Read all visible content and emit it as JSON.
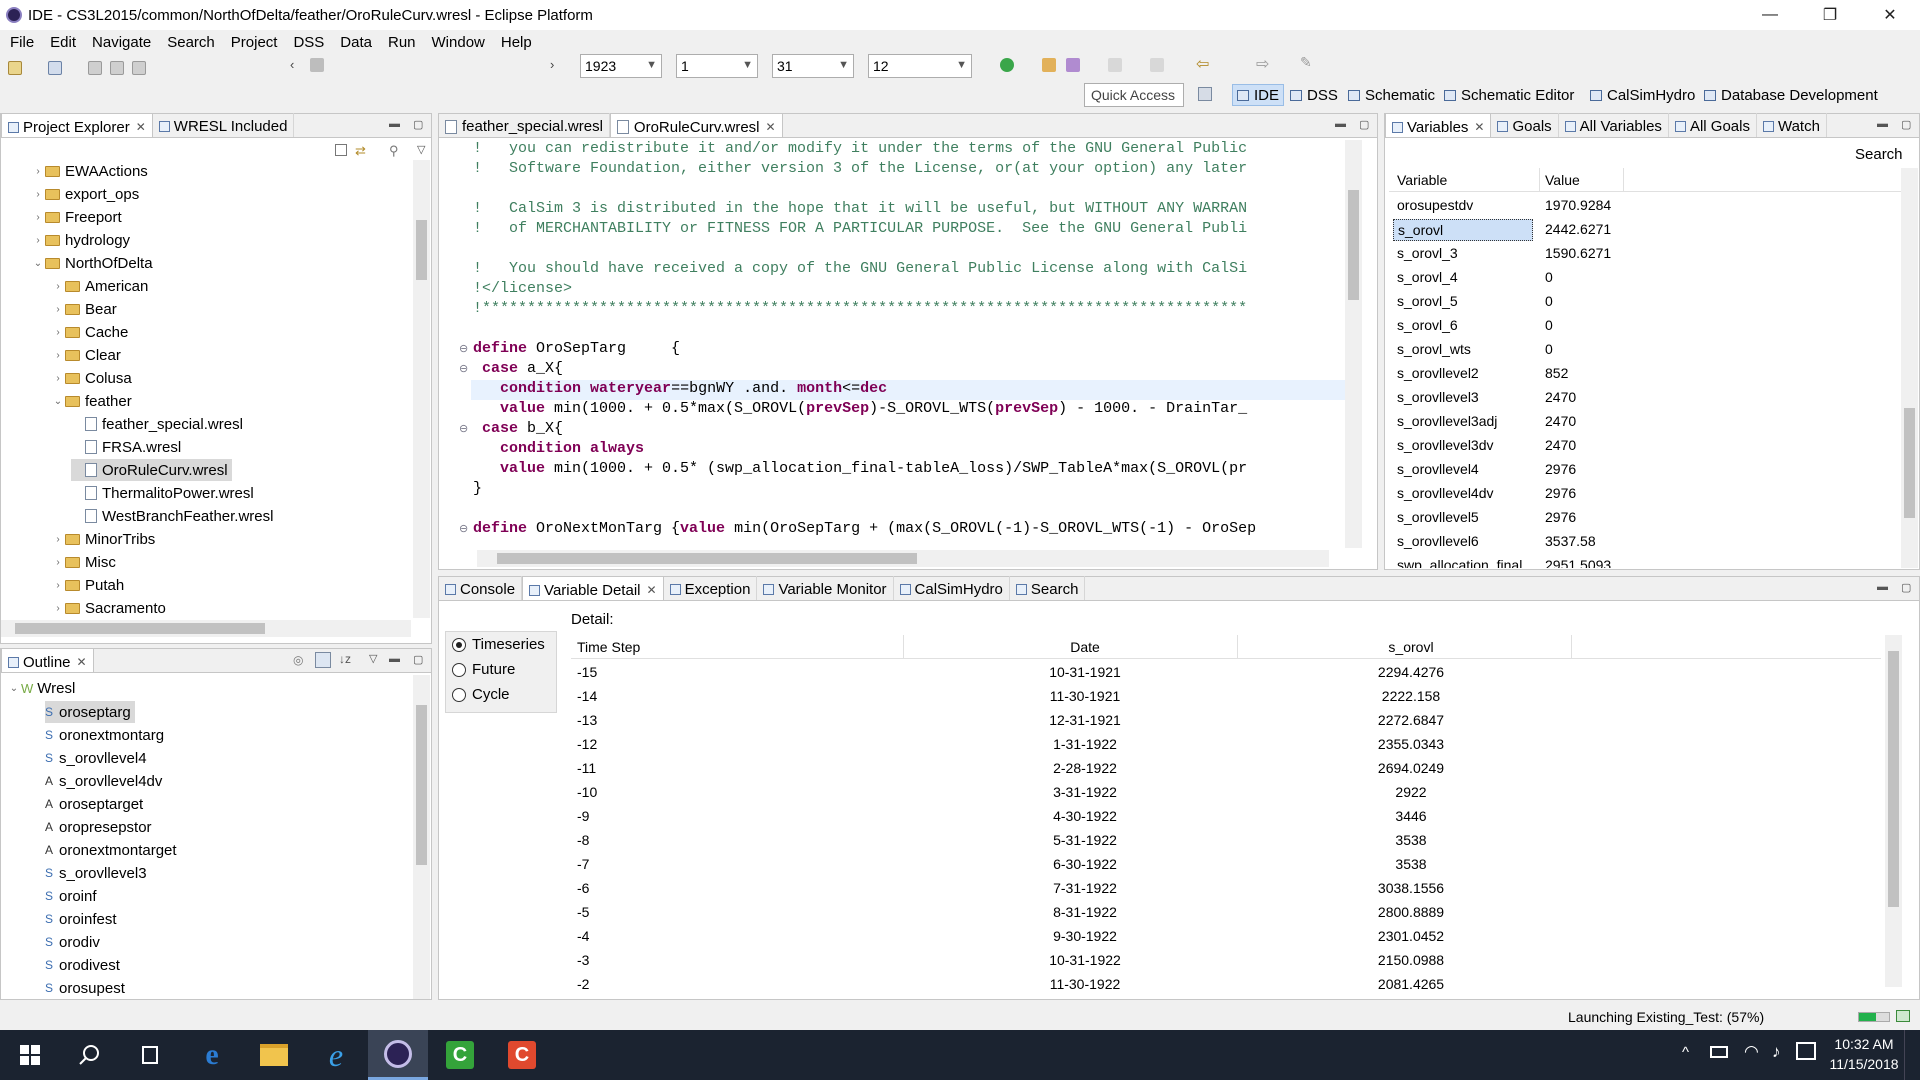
{
  "window": {
    "title": "IDE - CS3L2015/common/NorthOfDelta/feather/OroRuleCurv.wresl - Eclipse Platform",
    "minimize": "—",
    "restore": "❐",
    "close": "✕"
  },
  "menu": [
    "File",
    "Edit",
    "Navigate",
    "Search",
    "Project",
    "DSS",
    "Data",
    "Run",
    "Window",
    "Help"
  ],
  "toolbar": {
    "year": "1923",
    "day": "1",
    "day2": "31",
    "month": "12",
    "quick_access": "Quick Access"
  },
  "perspectives": [
    "IDE",
    "DSS",
    "Schematic",
    "Schematic Editor",
    "CalSimHydro",
    "Database Development"
  ],
  "left_top": {
    "tabs": [
      "Project Explorer",
      "WRESL Included"
    ],
    "items": [
      {
        "label": "EWAActions",
        "type": "folder",
        "twist": "›"
      },
      {
        "label": "export_ops",
        "type": "folder",
        "twist": "›"
      },
      {
        "label": "Freeport",
        "type": "folder",
        "twist": "›"
      },
      {
        "label": "hydrology",
        "type": "folder",
        "twist": "›"
      },
      {
        "label": "NorthOfDelta",
        "type": "folder",
        "twist": "⌄"
      },
      {
        "label": "American",
        "type": "folder",
        "twist": "›"
      },
      {
        "label": "Bear",
        "type": "folder",
        "twist": "›"
      },
      {
        "label": "Cache",
        "type": "folder",
        "twist": "›"
      },
      {
        "label": "Clear",
        "type": "folder",
        "twist": "›"
      },
      {
        "label": "Colusa",
        "type": "folder",
        "twist": "›"
      },
      {
        "label": "feather",
        "type": "folder",
        "twist": "⌄"
      },
      {
        "label": "feather_special.wresl",
        "type": "file",
        "twist": ""
      },
      {
        "label": "FRSA.wresl",
        "type": "file",
        "twist": ""
      },
      {
        "label": "OroRuleCurv.wresl",
        "type": "file",
        "twist": ""
      },
      {
        "label": "ThermalitoPower.wresl",
        "type": "file",
        "twist": ""
      },
      {
        "label": "WestBranchFeather.wresl",
        "type": "file",
        "twist": ""
      },
      {
        "label": "MinorTribs",
        "type": "folder",
        "twist": "›"
      },
      {
        "label": "Misc",
        "type": "folder",
        "twist": "›"
      },
      {
        "label": "Putah",
        "type": "folder",
        "twist": "›"
      },
      {
        "label": "Sacramento",
        "type": "folder",
        "twist": "›"
      }
    ]
  },
  "outline": {
    "tab": "Outline",
    "root": "Wresl",
    "items": [
      {
        "prefix": "S",
        "label": "oroseptarg"
      },
      {
        "prefix": "S",
        "label": "oronextmontarg"
      },
      {
        "prefix": "S",
        "label": "s_orovllevel4"
      },
      {
        "prefix": "A",
        "label": "s_orovllevel4dv"
      },
      {
        "prefix": "A",
        "label": "oroseptarget"
      },
      {
        "prefix": "A",
        "label": "oropresepstor"
      },
      {
        "prefix": "A",
        "label": "oronextmontarget"
      },
      {
        "prefix": "S",
        "label": "s_orovllevel3"
      },
      {
        "prefix": "S",
        "label": "oroinf"
      },
      {
        "prefix": "S",
        "label": "oroinfest"
      },
      {
        "prefix": "S",
        "label": "orodiv"
      },
      {
        "prefix": "S",
        "label": "orodivest"
      },
      {
        "prefix": "S",
        "label": "orosupest"
      }
    ]
  },
  "editor": {
    "tabs": [
      "feather_special.wresl",
      "OroRuleCurv.wresl"
    ],
    "lines": [
      {
        "t": "!   you can redistribute it and/or modify it under the terms of the GNU General Public",
        "c": "cm"
      },
      {
        "t": "!   Software Foundation, either version 3 of the License, or(at your option) any later",
        "c": "cm"
      },
      {
        "t": "",
        "c": ""
      },
      {
        "t": "!   CalSim 3 is distributed in the hope that it will be useful, but WITHOUT ANY WARRAN",
        "c": "cm"
      },
      {
        "t": "!   of MERCHANTABILITY or FITNESS FOR A PARTICULAR PURPOSE.  See the GNU General Publi",
        "c": "cm"
      },
      {
        "t": "",
        "c": ""
      },
      {
        "t": "!   You should have received a copy of the GNU General Public License along with CalSi",
        "c": "cm"
      },
      {
        "t": "!</license>",
        "c": "cm"
      },
      {
        "t": "!*************************************************************************************",
        "c": "cm"
      },
      {
        "t": "",
        "c": ""
      },
      {
        "t": "define OroSepTarg     {",
        "c": ""
      },
      {
        "t": " case a_X{",
        "c": ""
      },
      {
        "t": "   condition wateryear==bgnWY .and. month<=dec",
        "c": "hl"
      },
      {
        "t": "   value min(1000. + 0.5*max(S_OROVL(prevSep)-S_OROVL_WTS(prevSep) - 1000. - DrainTar_",
        "c": ""
      },
      {
        "t": " case b_X{",
        "c": ""
      },
      {
        "t": "   condition always",
        "c": ""
      },
      {
        "t": "   value min(1000. + 0.5* (swp_allocation_final-tableA_loss)/SWP_TableA*max(S_OROVL(pr",
        "c": ""
      },
      {
        "t": "}",
        "c": ""
      },
      {
        "t": "",
        "c": ""
      },
      {
        "t": "define OroNextMonTarg {value min(OroSepTarg + (max(S_OROVL(-1)-S_OROVL_WTS(-1) - OroSep",
        "c": ""
      }
    ]
  },
  "variables": {
    "tabs": [
      "Variables",
      "Goals",
      "All Variables",
      "All Goals",
      "Watch"
    ],
    "search": "Search",
    "headers": [
      "Variable",
      "Value"
    ],
    "rows": [
      [
        "orosupestdv",
        "1970.9284"
      ],
      [
        "s_orovl",
        "2442.6271"
      ],
      [
        "s_orovl_3",
        "1590.6271"
      ],
      [
        "s_orovl_4",
        "0"
      ],
      [
        "s_orovl_5",
        "0"
      ],
      [
        "s_orovl_6",
        "0"
      ],
      [
        "s_orovl_wts",
        "0"
      ],
      [
        "s_orovllevel2",
        "852"
      ],
      [
        "s_orovllevel3",
        "2470"
      ],
      [
        "s_orovllevel3adj",
        "2470"
      ],
      [
        "s_orovllevel3dv",
        "2470"
      ],
      [
        "s_orovllevel4",
        "2976"
      ],
      [
        "s_orovllevel4dv",
        "2976"
      ],
      [
        "s_orovllevel5",
        "2976"
      ],
      [
        "s_orovllevel6",
        "3537.58"
      ],
      [
        "swp_allocation_final",
        "2951.5093"
      ]
    ]
  },
  "bottom": {
    "tabs": [
      "Console",
      "Variable Detail",
      "Exception",
      "Variable Monitor",
      "CalSimHydro",
      "Search"
    ],
    "detail_label": "Detail:",
    "radios": [
      {
        "label": "Timeseries",
        "checked": true
      },
      {
        "label": "Future",
        "checked": false
      },
      {
        "label": "Cycle",
        "checked": false
      }
    ],
    "headers": [
      "Time Step",
      "Date",
      "s_orovl"
    ],
    "rows": [
      [
        "-15",
        "10-31-1921",
        "2294.4276"
      ],
      [
        "-14",
        "11-30-1921",
        "2222.158"
      ],
      [
        "-13",
        "12-31-1921",
        "2272.6847"
      ],
      [
        "-12",
        "1-31-1922",
        "2355.0343"
      ],
      [
        "-11",
        "2-28-1922",
        "2694.0249"
      ],
      [
        "-10",
        "3-31-1922",
        "2922"
      ],
      [
        "-9",
        "4-30-1922",
        "3446"
      ],
      [
        "-8",
        "5-31-1922",
        "3538"
      ],
      [
        "-7",
        "6-30-1922",
        "3538"
      ],
      [
        "-6",
        "7-31-1922",
        "3038.1556"
      ],
      [
        "-5",
        "8-31-1922",
        "2800.8889"
      ],
      [
        "-4",
        "9-30-1922",
        "2301.0452"
      ],
      [
        "-3",
        "10-31-1922",
        "2150.0988"
      ],
      [
        "-2",
        "11-30-1922",
        "2081.4265"
      ]
    ]
  },
  "status": {
    "text": "Launching Existing_Test: (57%)",
    "progress": 0.57
  },
  "taskbar": {
    "time": "10:32 AM",
    "date": "11/15/2018"
  }
}
